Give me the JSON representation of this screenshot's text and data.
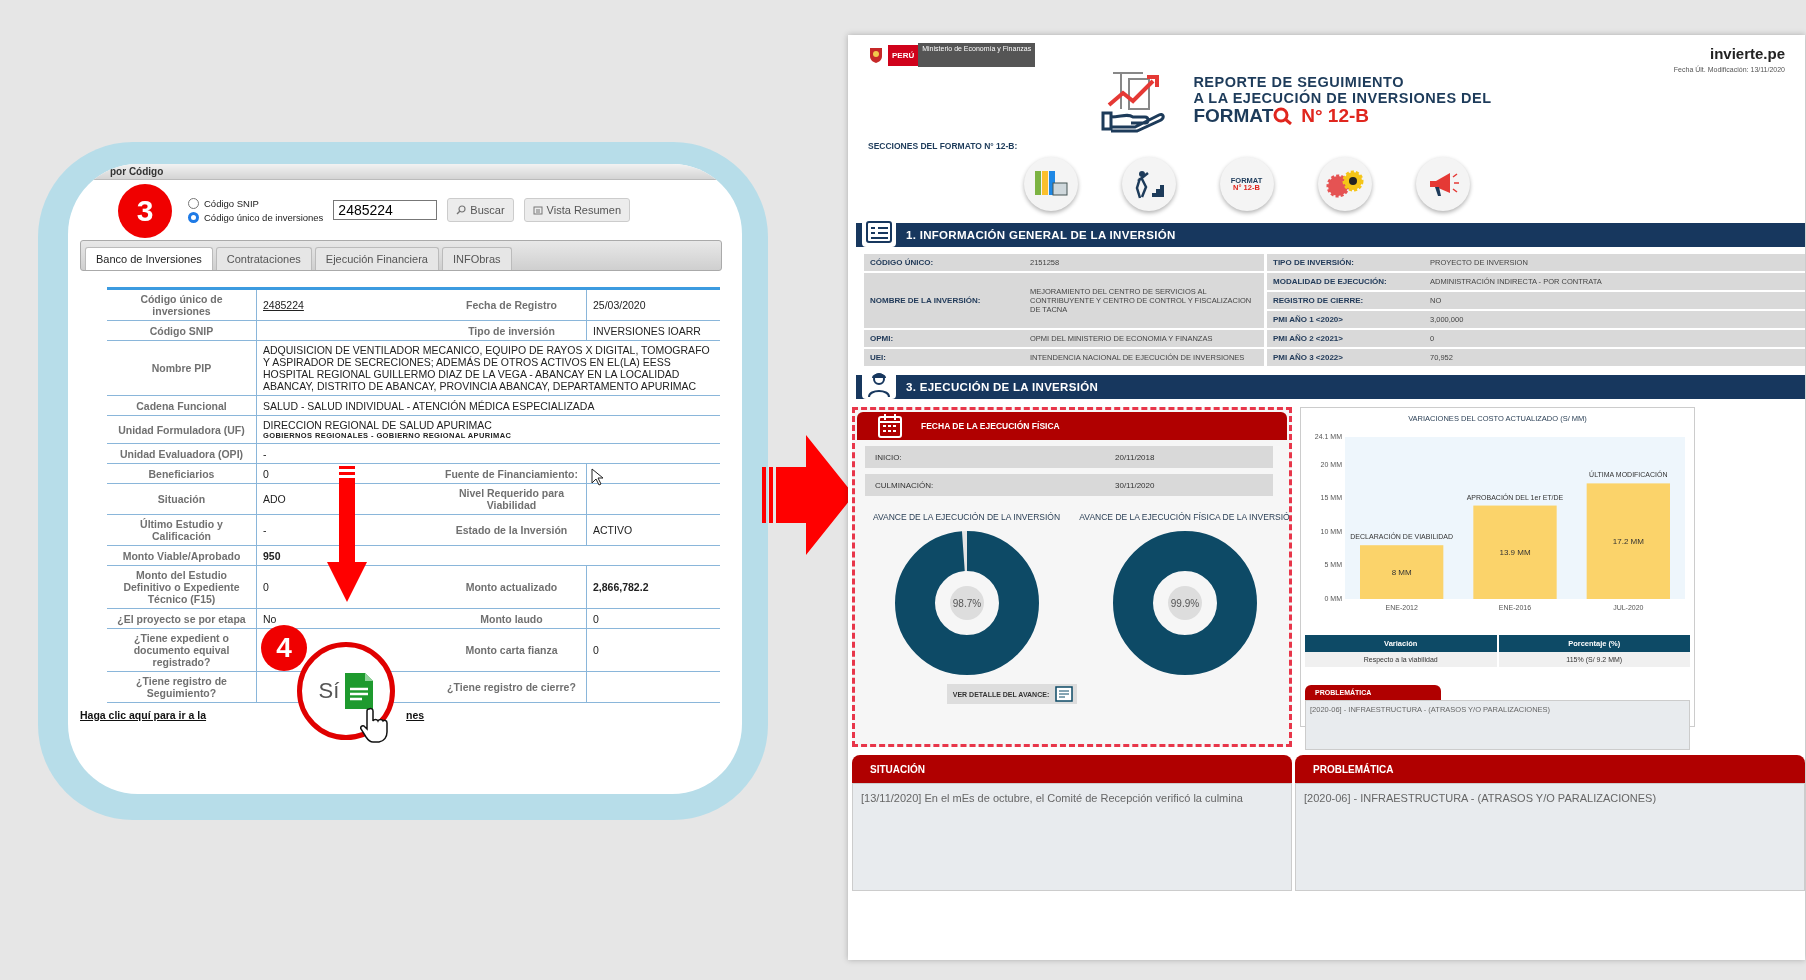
{
  "left_panel": {
    "title": "por Código",
    "step_badges": [
      {
        "label": "3"
      },
      {
        "label": "4"
      }
    ],
    "radios": [
      {
        "label": "Código SNIP",
        "selected": false
      },
      {
        "label": "Código único de inversiones",
        "selected": true
      }
    ],
    "code_field": {
      "value": "2485224"
    },
    "buttons": [
      {
        "label": "Buscar",
        "kind": "search"
      },
      {
        "label": "Vista Resumen",
        "kind": "summary"
      }
    ],
    "tabs": [
      {
        "label": "Banco de Inversiones",
        "selected": true
      },
      {
        "label": "Contrataciones",
        "selected": false
      },
      {
        "label": "Ejecución Financiera",
        "selected": false
      },
      {
        "label": "INFObras",
        "selected": false
      }
    ],
    "rows": [
      {
        "kind": "pair",
        "label": "Código único de inversiones",
        "value": "2485224",
        "value_link": true,
        "label2": "Fecha de Registro",
        "value2": "25/03/2020"
      },
      {
        "kind": "pair",
        "label": "Código SNIP",
        "label2": "Tipo de inversión",
        "value2": "INVERSIONES IOARR"
      },
      {
        "kind": "wide",
        "label": "Nombre PIP",
        "value": "ADQUISICION DE VENTILADOR MECANICO, EQUIPO DE RAYOS X DIGITAL, TOMOGRAFO Y ASPIRADOR DE SECRECIONES; ADEMÁS DE OTROS ACTIVOS EN EL(LA) EESS HOSPITAL REGIONAL GUILLERMO DIAZ DE LA VEGA - ABANCAY EN LA LOCALIDAD ABANCAY, DISTRITO DE ABANCAY, PROVINCIA ABANCAY, DEPARTAMENTO APURIMAC"
      },
      {
        "kind": "wide",
        "label": "Cadena Funcional",
        "value": "SALUD - SALUD INDIVIDUAL - ATENCIÓN MÉDICA ESPECIALIZADA"
      },
      {
        "kind": "wide",
        "label": "Unidad Formuladora (UF)",
        "value": "DIRECCION REGIONAL DE SALUD APURIMAC",
        "value_sub": "GOBIERNOS REGIONALES - GOBIERNO REGIONAL APURIMAC"
      },
      {
        "kind": "wide",
        "label": "Unidad Evaluadora (OPI)",
        "value": "-"
      },
      {
        "kind": "pair",
        "label": "Beneficiarios",
        "value": "0",
        "label2": "Fuente de Financiamiento:"
      },
      {
        "kind": "pair",
        "label": "Situación",
        "value": "ADO",
        "label2": "Nivel Requerido para Viabilidad"
      },
      {
        "kind": "pair",
        "label": "Último Estudio y Calificación",
        "value": "-",
        "label2": "Estado de la Inversión",
        "value2": "ACTIVO"
      },
      {
        "kind": "wide",
        "label": "Monto Viable/Aprobado",
        "value": "950",
        "value_bold": true
      },
      {
        "kind": "pair",
        "label": "Monto del Estudio Definitivo o Expediente Técnico (F15)",
        "value": "0",
        "label2": "Monto actualizado",
        "value2": "2,866,782.2",
        "value2_bold": true
      },
      {
        "kind": "pair",
        "label": "¿El proyecto se por etapa",
        "value": "No",
        "label2": "Monto laudo",
        "value2": "0"
      },
      {
        "kind": "pair",
        "label": "¿Tiene expedient o documento equival registrado?",
        "label2": "Monto carta fianza",
        "value2": "0"
      },
      {
        "kind": "pair",
        "label": "¿Tiene registro de Seguimiento?",
        "label2": "¿Tiene registro de cierre?"
      }
    ],
    "magnifier": {
      "value": "Sí"
    },
    "link_start": "Haga clic aquí para ir a la",
    "link_end": "nes"
  },
  "report": {
    "logo_country": "PERÚ",
    "logo_ministry": "Ministerio de Economía y Finanzas",
    "brand": "invierte.pe",
    "modified": "Fecha Últ. Modificación: 13/11/2020",
    "title_lines": [
      "REPORTE DE SEGUIMIENTO",
      "A LA EJECUCIÓN DE INVERSIONES DEL"
    ],
    "title_format": "FORMAT",
    "title_number": "N° 12-B",
    "sections_label": "SECCIONES DEL FORMATO N° 12-B:",
    "section_icons": [
      {
        "kind": "binders"
      },
      {
        "kind": "worker"
      },
      {
        "kind": "format",
        "text": "FORMAT",
        "number": "N° 12-B"
      },
      {
        "kind": "gears"
      },
      {
        "kind": "megaphone"
      }
    ],
    "general": {
      "title": "1. INFORMACIÓN GENERAL DE LA INVERSIÓN",
      "left": [
        {
          "label": "CÓDIGO ÚNICO:",
          "value": "2151258"
        },
        {
          "label": "NOMBRE DE LA INVERSIÓN:",
          "value": "MEJORAMIENTO DEL CENTRO DE SERVICIOS AL CONTRIBUYENTE Y CENTRO DE CONTROL Y FISCALIZACION DE TACNA"
        },
        {
          "label": "OPMI:",
          "value": "OPMI DEL MINISTERIO DE ECONOMIA Y FINANZAS"
        },
        {
          "label": "UEI:",
          "value": "INTENDENCIA NACIONAL DE EJECUCIÓN DE INVERSIONES"
        }
      ],
      "right": [
        {
          "label": "TIPO DE INVERSIÓN:",
          "value": "PROYECTO DE INVERSION"
        },
        {
          "label": "MODALIDAD DE EJECUCIÓN:",
          "value": "ADMINISTRACIÓN INDIRECTA - POR CONTRATA"
        },
        {
          "label": "REGISTRO DE CIERRE:",
          "value": "NO"
        },
        {
          "label": "PMI AÑO 1 <2020>",
          "value": "3,000,000"
        },
        {
          "label": "PMI AÑO 2 <2021>",
          "value": "0"
        },
        {
          "label": "PMI AÑO 3 <2022>",
          "value": "70,952"
        }
      ]
    },
    "execution": {
      "title": "3. EJECUCIÓN DE LA INVERSIÓN",
      "dates_title": "FECHA DE LA EJECUCIÓN FÍSICA",
      "dates": [
        {
          "label": "INICIO:",
          "value": "20/11/2018"
        },
        {
          "label": "CULMINACIÓN:",
          "value": "30/11/2020"
        }
      ],
      "donuts": [
        {
          "title": "AVANCE DE LA EJECUCIÓN DE LA INVERSIÓN",
          "reading": "98.7%",
          "level": 0.987
        },
        {
          "title": "AVANCE DE LA EJECUCIÓN FÍSICA DE LA INVERSIÓ",
          "reading": "99.9%",
          "level": 0.999
        }
      ],
      "detail_button": "VER DETALLE DEL AVANCE:",
      "chart_data": {
        "type": "bar",
        "title": "VARIACIONES DEL COSTO ACTUALIZADO (S/ MM)",
        "categories": [
          "ENE-2012",
          "ENE-2016",
          "JUL-2020"
        ],
        "series": [
          {
            "color": "#fbd36a",
            "values": [
              8,
              13.9,
              17.2
            ]
          }
        ],
        "ylim": [
          0,
          24.1
        ],
        "yticks": [
          {
            "value": 0,
            "label": "0 MM"
          },
          {
            "value": 5,
            "label": "5 MM"
          },
          {
            "value": 10,
            "label": "10 MM"
          },
          {
            "value": 15,
            "label": "15 MM"
          },
          {
            "value": 20,
            "label": "20 MM"
          },
          {
            "value": 24.1,
            "label": "24.1 MM"
          }
        ],
        "value_labels": [
          "8 MM",
          "13.9 MM",
          "17.2 MM"
        ],
        "annotations": [
          "DECLARACIÓN DE VIABILIDAD",
          "APROBACIÓN DEL 1er ET/DE",
          "ÚLTIMA MODIFICACIÓN"
        ]
      },
      "variation_table": {
        "columns": [
          "Variación",
          "Porcentaje (%)"
        ],
        "rows": [
          [
            "Respecto a la viabilidad",
            "115% (S/ 9.2 MM)"
          ]
        ]
      },
      "problem_box": {
        "title": "PROBLEMÁTICA",
        "text": "[2020-06] - INFRAESTRUCTURA -  (ATRASOS Y/O PARALIZACIONES)"
      }
    },
    "bottom_panels": [
      {
        "title": "SITUACIÓN",
        "text": "[13/11/2020] En el mEs de octubre, el Comité de Recepción verificó la culmina"
      },
      {
        "title": "PROBLEMÁTICA",
        "text": "[2020-06] - INFRAESTRUCTURA -  (ATRASOS Y/O PARALIZACIONES)"
      }
    ]
  }
}
